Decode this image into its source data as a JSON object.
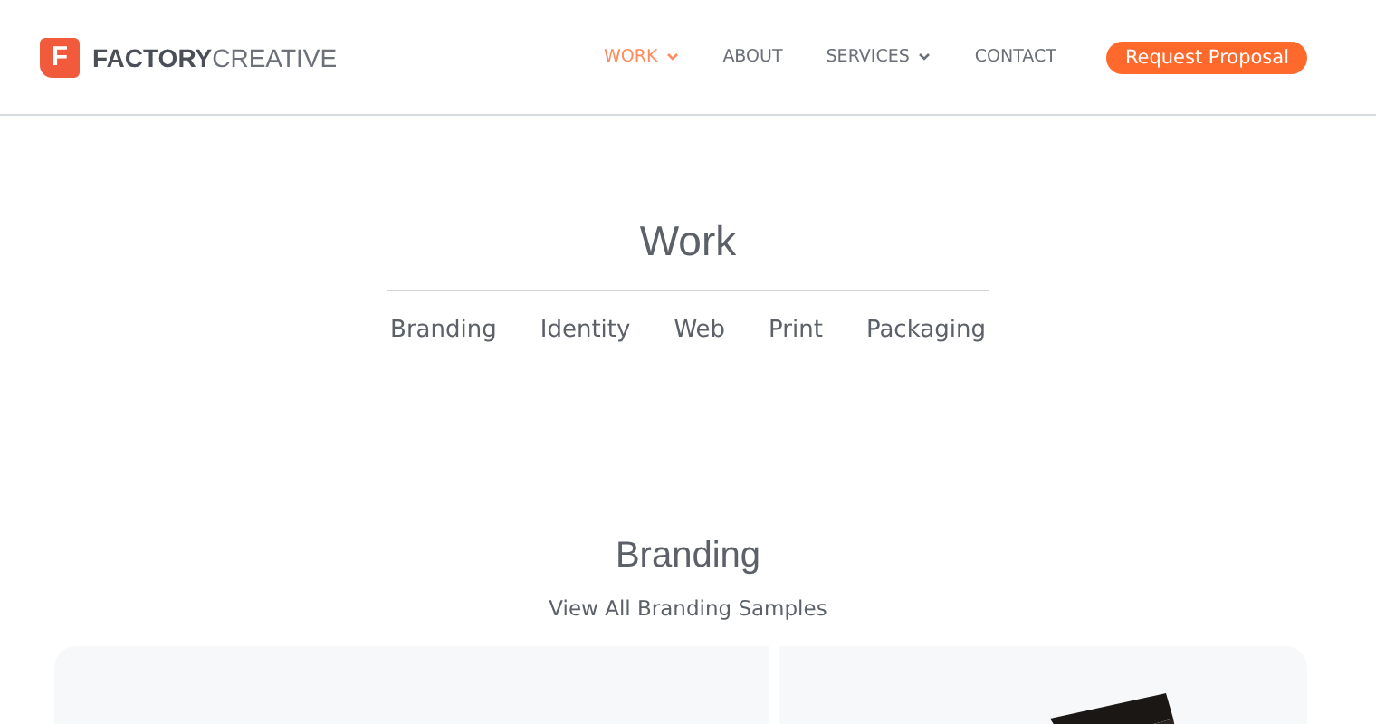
{
  "header": {
    "logo": {
      "mark": "F",
      "bold": "FACTORY",
      "light": "CREATIVE"
    },
    "nav": [
      {
        "label": "WORK",
        "selected": true,
        "has_menu": true
      },
      {
        "label": "ABOUT",
        "selected": false,
        "has_menu": false
      },
      {
        "label": "SERVICES",
        "selected": false,
        "has_menu": true
      },
      {
        "label": "CONTACT",
        "selected": false,
        "has_menu": false
      }
    ],
    "cta": "Request Proposal"
  },
  "page_title": "Work",
  "filters": [
    "Branding",
    "Identity",
    "Web",
    "Print",
    "Packaging"
  ],
  "section": {
    "title": "Branding",
    "link": "View All Branding Samples",
    "cards": [
      {
        "kind": "blank"
      },
      {
        "kind": "picture"
      }
    ]
  }
}
